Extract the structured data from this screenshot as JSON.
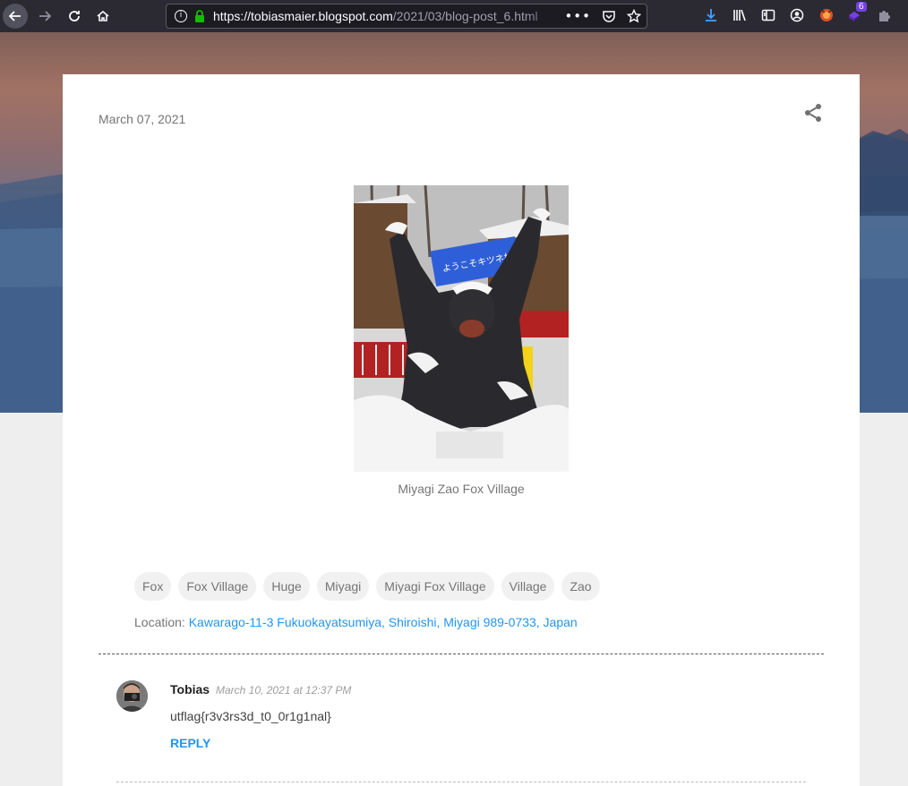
{
  "browser": {
    "url_host": "https://tobiasmaier.blogspot.com",
    "url_path": "/2021/03/blog-post_6.html",
    "more_icon": "ellipsis-icon",
    "downloads_badge": "6"
  },
  "post": {
    "date": "March 07, 2021",
    "image_caption": "Miyagi Zao Fox Village",
    "sign_text": "ようこそキツネ村へ!",
    "labels": [
      "Fox",
      "Fox Village",
      "Huge",
      "Miyagi",
      "Miyagi Fox Village",
      "Village",
      "Zao"
    ],
    "location_label": "Location:",
    "location_value": "Kawarago-11-3 Fukuokayatsumiya, Shiroishi, Miyagi 989-0733, Japan"
  },
  "comment": {
    "author": "Tobias",
    "time": "March 10, 2021 at 12:37 PM",
    "body": "utflag{r3v3rs3d_t0_0r1g1nal}",
    "reply_label": "REPLY"
  },
  "colors": {
    "link": "#2196f3",
    "chip_bg": "#f1f1f1",
    "toolbar_bg": "#2b2a33"
  }
}
